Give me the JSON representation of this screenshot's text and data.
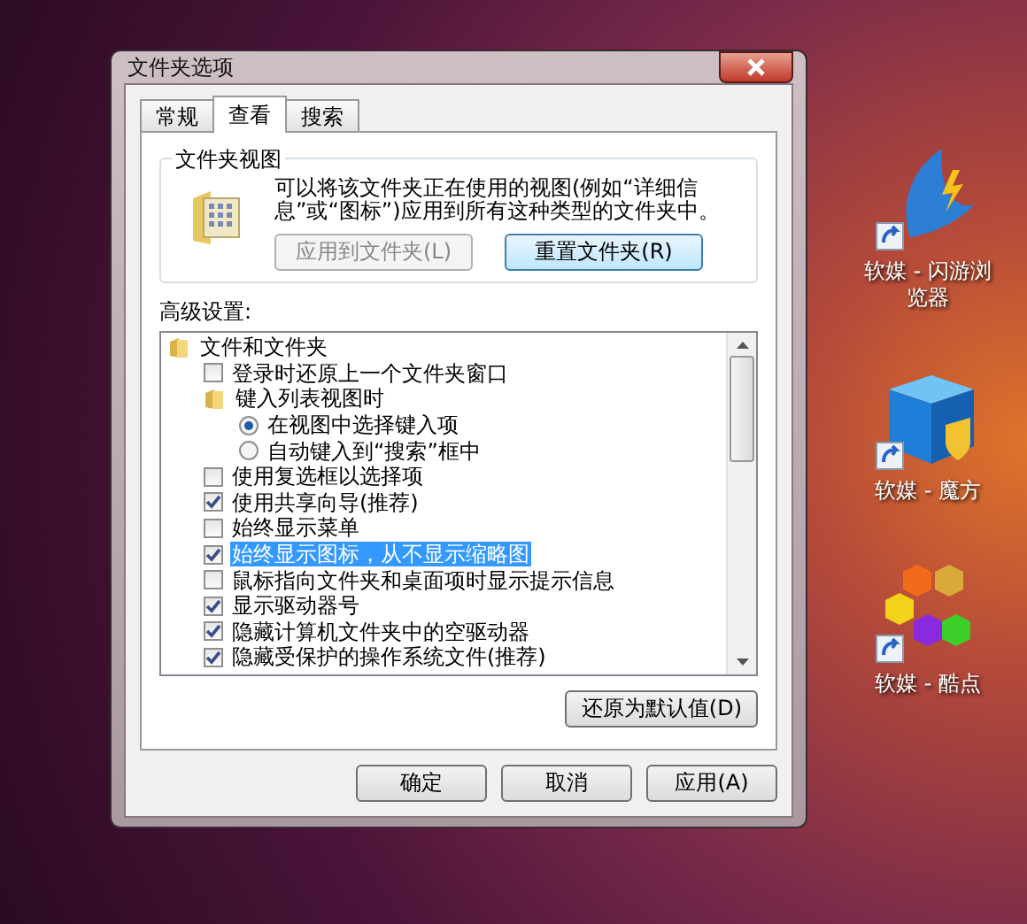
{
  "window": {
    "title": "文件夹选项"
  },
  "tabs": [
    {
      "label": "常规",
      "selected": false
    },
    {
      "label": "查看",
      "selected": true
    },
    {
      "label": "搜索",
      "selected": false
    }
  ],
  "folder_views": {
    "title": "文件夹视图",
    "description": "可以将该文件夹正在使用的视图(例如“详细信息”或“图标”)应用到所有这种类型的文件夹中。",
    "buttons": [
      {
        "label": "应用到文件夹(L)",
        "disabled": true
      },
      {
        "label": "重置文件夹(R)",
        "disabled": false
      }
    ]
  },
  "advanced": {
    "label": "高级设置:",
    "tree": [
      {
        "kind": "folder",
        "label": "文件和文件夹",
        "selected": false,
        "children": [
          {
            "kind": "checkbox",
            "label": "登录时还原上一个文件夹窗口",
            "checked": false,
            "selected": false
          },
          {
            "kind": "folder",
            "label": "键入列表视图时",
            "selected": false,
            "children": [
              {
                "kind": "radio",
                "label": "在视图中选择键入项",
                "checked": true,
                "selected": false
              },
              {
                "kind": "radio",
                "label": "自动键入到“搜索”框中",
                "checked": false,
                "selected": false
              }
            ]
          },
          {
            "kind": "checkbox",
            "label": "使用复选框以选择项",
            "checked": false,
            "selected": false
          },
          {
            "kind": "checkbox",
            "label": "使用共享向导(推荐)",
            "checked": true,
            "selected": false
          },
          {
            "kind": "checkbox",
            "label": "始终显示菜单",
            "checked": false,
            "selected": false
          },
          {
            "kind": "checkbox",
            "label": "始终显示图标，从不显示缩略图",
            "checked": true,
            "selected": true
          },
          {
            "kind": "checkbox",
            "label": "鼠标指向文件夹和桌面项时显示提示信息",
            "checked": false,
            "selected": false
          },
          {
            "kind": "checkbox",
            "label": "显示驱动器号",
            "checked": true,
            "selected": false
          },
          {
            "kind": "checkbox",
            "label": "隐藏计算机文件夹中的空驱动器",
            "checked": true,
            "selected": false
          },
          {
            "kind": "checkbox",
            "label": "隐藏受保护的操作系统文件(推荐)",
            "checked": true,
            "selected": false
          }
        ]
      }
    ],
    "restore_button": "还原为默认值(D)"
  },
  "footer_buttons": [
    "确定",
    "取消",
    "应用(A)"
  ],
  "desktop_icons": [
    {
      "kind": "sail",
      "label": "软媒 - 闪游浏览器"
    },
    {
      "kind": "cube",
      "label": "软媒 - 魔方"
    },
    {
      "kind": "hexagons",
      "label": "软媒 - 酷点"
    }
  ]
}
